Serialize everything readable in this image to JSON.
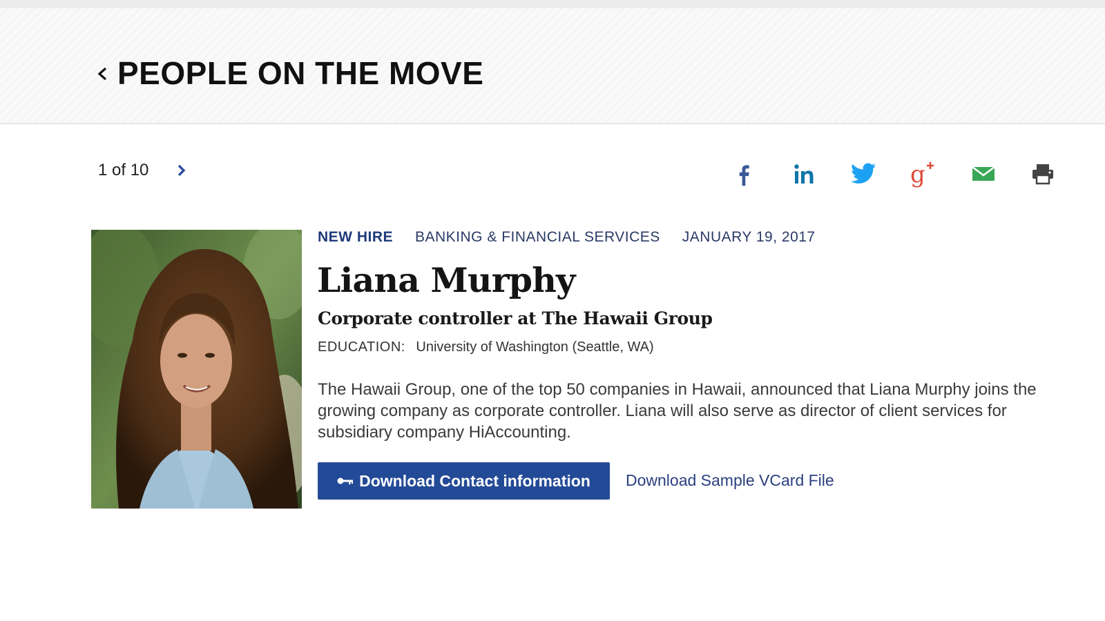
{
  "header": {
    "section_title": "PEOPLE ON THE MOVE",
    "back_icon": "chevron-left-icon"
  },
  "pager": {
    "count": "1 of 10",
    "next_icon": "chevron-right-icon"
  },
  "share": [
    {
      "name": "facebook-icon",
      "color": "#3b5998"
    },
    {
      "name": "linkedin-icon",
      "color": "#0e76a8"
    },
    {
      "name": "twitter-icon",
      "color": "#1da1f2"
    },
    {
      "name": "google-plus-icon",
      "color": "#dd4b39"
    },
    {
      "name": "email-icon",
      "color": "#3aa757"
    },
    {
      "name": "print-icon",
      "color": "#444444"
    }
  ],
  "profile": {
    "type": "NEW HIRE",
    "industry": "BANKING & FINANCIAL SERVICES",
    "date": "JANUARY 19, 2017",
    "name": "Liana Murphy",
    "title": "Corporate controller at The Hawaii Group",
    "education_label": "EDUCATION:",
    "education_value": "University of Washington (Seattle, WA)",
    "bio": "The Hawaii Group, one of the top 50 companies in Hawaii, announced that Liana Murphy joins the growing company as corporate controller. Liana will also serve as director of client services for subsidiary company HiAccounting."
  },
  "actions": {
    "download_contact": "Download Contact information",
    "download_vcard": "Download Sample VCard File",
    "button_color": "#234a96"
  }
}
